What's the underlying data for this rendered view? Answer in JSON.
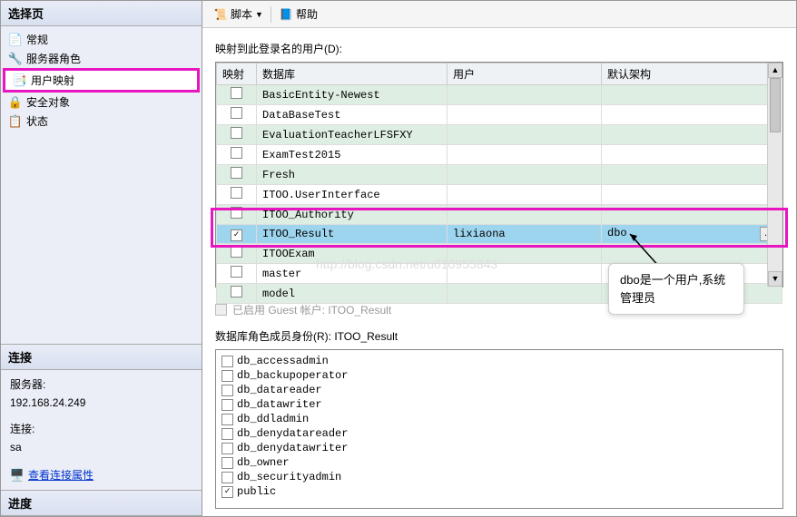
{
  "left": {
    "title": "选择页",
    "nav": [
      {
        "icon": "📄",
        "label": "常规"
      },
      {
        "icon": "🔧",
        "label": "服务器角色"
      },
      {
        "icon": "📑",
        "label": "用户映射"
      },
      {
        "icon": "🔒",
        "label": "安全对象"
      },
      {
        "icon": "📋",
        "label": "状态"
      }
    ],
    "connect_header": "连接",
    "server_label": "服务器:",
    "server_value": "192.168.24.249",
    "conn_label": "连接:",
    "conn_value": "sa",
    "view_props": "查看连接属性",
    "progress_header": "进度"
  },
  "toolbar": {
    "script": "脚本",
    "help": "帮助"
  },
  "main": {
    "mapping_label": "映射到此登录名的用户(D):",
    "headers": {
      "map": "映射",
      "db": "数据库",
      "user": "用户",
      "schema": "默认架构"
    },
    "rows": [
      {
        "checked": false,
        "db": "BasicEntity-Newest",
        "user": "",
        "schema": "",
        "alt": true
      },
      {
        "checked": false,
        "db": "DataBaseTest",
        "user": "",
        "schema": "",
        "alt": false
      },
      {
        "checked": false,
        "db": "EvaluationTeacherLFSFXY",
        "user": "",
        "schema": "",
        "alt": true
      },
      {
        "checked": false,
        "db": "ExamTest2015",
        "user": "",
        "schema": "",
        "alt": false
      },
      {
        "checked": false,
        "db": "Fresh",
        "user": "",
        "schema": "",
        "alt": true
      },
      {
        "checked": false,
        "db": "ITOO.UserInterface",
        "user": "",
        "schema": "",
        "alt": false
      },
      {
        "checked": false,
        "db": "ITOO_Authority",
        "user": "",
        "schema": "",
        "alt": true
      },
      {
        "checked": true,
        "db": "ITOO_Result",
        "user": "lixiaona",
        "schema": "dbo",
        "sel": true
      },
      {
        "checked": false,
        "db": "ITOOExam",
        "user": "",
        "schema": "",
        "alt": true
      },
      {
        "checked": false,
        "db": "master",
        "user": "",
        "schema": "",
        "alt": false
      },
      {
        "checked": false,
        "db": "model",
        "user": "",
        "schema": "",
        "alt": true
      }
    ],
    "guest_label": "已启用 Guest 帐户: ITOO_Result",
    "roles_label": "数据库角色成员身份(R): ITOO_Result",
    "roles": [
      {
        "checked": false,
        "name": "db_accessadmin"
      },
      {
        "checked": false,
        "name": "db_backupoperator"
      },
      {
        "checked": false,
        "name": "db_datareader"
      },
      {
        "checked": false,
        "name": "db_datawriter"
      },
      {
        "checked": false,
        "name": "db_ddladmin"
      },
      {
        "checked": false,
        "name": "db_denydatareader"
      },
      {
        "checked": false,
        "name": "db_denydatawriter"
      },
      {
        "checked": false,
        "name": "db_owner"
      },
      {
        "checked": false,
        "name": "db_securityadmin"
      },
      {
        "checked": true,
        "name": "public"
      }
    ]
  },
  "watermark": "http://blog.csdn.net/u010955843",
  "annotation": "dbo是一个用户,系统管理员"
}
